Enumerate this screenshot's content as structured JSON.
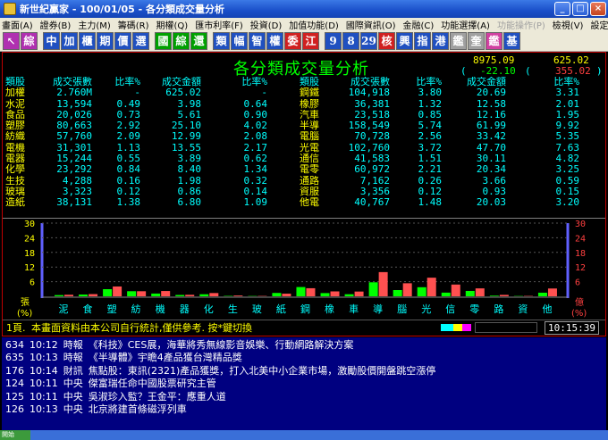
{
  "window": {
    "title": "新世紀贏家 - 100/01/05 - 各分類成交量分析",
    "min": "_",
    "max": "□",
    "close": "×"
  },
  "menu": [
    "畫面(A)",
    "證券(B)",
    "主力(M)",
    "籌碼(R)",
    "期權(Q)",
    "匯市利率(F)",
    "投資(D)",
    "加值功能(D)",
    "國際資訊(O)",
    "金融(C)",
    "功能選擇(A)",
    "功能操作(P)",
    "檢視(V)",
    "設定(S)",
    "工具(T)",
    "說明(H)"
  ],
  "menu_disabled": [
    11
  ],
  "toolbar": [
    {
      "t": "↖",
      "bg": "#b030b0"
    },
    {
      "t": "綜",
      "bg": "#b030b0"
    },
    {
      "t": "中",
      "bg": "#2050c0"
    },
    {
      "t": "加",
      "bg": "#2050c0"
    },
    {
      "t": "櫃",
      "bg": "#2050c0"
    },
    {
      "t": "期",
      "bg": "#2050c0"
    },
    {
      "t": "價",
      "bg": "#2050c0"
    },
    {
      "t": "選",
      "bg": "#2050c0"
    },
    {
      "t": "國",
      "bg": "#00a000"
    },
    {
      "t": "綜",
      "bg": "#00a000"
    },
    {
      "t": "還",
      "bg": "#00a000"
    },
    {
      "t": "類",
      "bg": "#2050c0"
    },
    {
      "t": "幅",
      "bg": "#2050c0"
    },
    {
      "t": "智",
      "bg": "#2050c0"
    },
    {
      "t": "權",
      "bg": "#2050c0"
    },
    {
      "t": "委",
      "bg": "#d02020"
    },
    {
      "t": "江",
      "bg": "#d02020"
    },
    {
      "t": "9",
      "bg": "#2050c0"
    },
    {
      "t": "8",
      "bg": "#2050c0"
    },
    {
      "t": "29",
      "bg": "#2050c0"
    },
    {
      "t": "核",
      "bg": "#d02020"
    },
    {
      "t": "興",
      "bg": "#2050c0"
    },
    {
      "t": "指",
      "bg": "#2050c0"
    },
    {
      "t": "港",
      "bg": "#2050c0"
    },
    {
      "t": "鑑",
      "bg": "#a0a0a0"
    },
    {
      "t": "奎",
      "bg": "#a0a0a0"
    },
    {
      "t": "鑑",
      "bg": "#d040a0"
    },
    {
      "t": "基",
      "bg": "#2050c0"
    }
  ],
  "header": {
    "title": "各分類成交量分析",
    "index_value": "8975.09",
    "index_change": "-22.10",
    "index2_value": "625.02",
    "index2_change": "355.02",
    "paren_open": "(",
    "paren_close": ")"
  },
  "columns": [
    "類股",
    "成交張數",
    "比率%",
    "成交金額",
    "比率%"
  ],
  "left_rows": [
    [
      "加權",
      "2.760M",
      "-",
      "625.02",
      "-"
    ],
    [
      "水泥",
      "13,594",
      "0.49",
      "3.98",
      "0.64"
    ],
    [
      "食品",
      "20,026",
      "0.73",
      "5.61",
      "0.90"
    ],
    [
      "塑膠",
      "80,663",
      "2.92",
      "25.10",
      "4.02"
    ],
    [
      "紡織",
      "57,760",
      "2.09",
      "12.99",
      "2.08"
    ],
    [
      "電機",
      "31,301",
      "1.13",
      "13.55",
      "2.17"
    ],
    [
      "電器",
      "15,244",
      "0.55",
      "3.89",
      "0.62"
    ],
    [
      "化學",
      "23,292",
      "0.84",
      "8.40",
      "1.34"
    ],
    [
      "生技",
      "4,288",
      "0.16",
      "1.98",
      "0.32"
    ],
    [
      "玻璃",
      "3,323",
      "0.12",
      "0.86",
      "0.14"
    ],
    [
      "造紙",
      "38,131",
      "1.38",
      "6.80",
      "1.09"
    ]
  ],
  "right_rows": [
    [
      "鋼鐵",
      "104,918",
      "3.80",
      "20.69",
      "3.31"
    ],
    [
      "橡膠",
      "36,381",
      "1.32",
      "12.58",
      "2.01"
    ],
    [
      "汽車",
      "23,518",
      "0.85",
      "12.16",
      "1.95"
    ],
    [
      "半導",
      "158,549",
      "5.74",
      "61.99",
      "9.92"
    ],
    [
      "電腦",
      "70,728",
      "2.56",
      "33.42",
      "5.35"
    ],
    [
      "光電",
      "102,760",
      "3.72",
      "47.70",
      "7.63"
    ],
    [
      "通信",
      "41,583",
      "1.51",
      "30.11",
      "4.82"
    ],
    [
      "電零",
      "60,972",
      "2.21",
      "20.34",
      "3.25"
    ],
    [
      "通路",
      "7,162",
      "0.26",
      "3.66",
      "0.59"
    ],
    [
      "資服",
      "3,356",
      "0.12",
      "0.93",
      "0.15"
    ],
    [
      "他電",
      "40,767",
      "1.48",
      "20.03",
      "3.20"
    ]
  ],
  "chart_data": {
    "type": "bar",
    "ylim": [
      0,
      30
    ],
    "yticks": [
      "30",
      "24",
      "18",
      "12",
      "6"
    ],
    "ylabel": "張 (%)",
    "ylabel_right": "億 (%)",
    "ylabel_left_top": "張",
    "ylabel_left_bottom": "(%)",
    "ylabel_right_top": "億",
    "ylabel_right_bottom": "(%)",
    "categories": [
      "泥",
      "食",
      "塑",
      "紡",
      "機",
      "器",
      "化",
      "生",
      "玻",
      "紙",
      "鋼",
      "橡",
      "車",
      "導",
      "腦",
      "光",
      "信",
      "零",
      "路",
      "資",
      "他"
    ],
    "series": [
      {
        "name": "成交張數比率",
        "color": "#00ff00",
        "values": [
          0.49,
          0.73,
          2.92,
          2.09,
          1.13,
          0.55,
          0.84,
          0.16,
          0.12,
          1.38,
          3.8,
          1.32,
          0.85,
          5.74,
          2.56,
          3.72,
          1.51,
          2.21,
          0.26,
          0.12,
          1.48
        ]
      },
      {
        "name": "成交金額比率",
        "color": "#ff5050",
        "values": [
          0.64,
          0.9,
          4.02,
          2.08,
          2.17,
          0.62,
          1.34,
          0.32,
          0.14,
          1.09,
          3.31,
          2.01,
          1.95,
          9.92,
          5.35,
          7.63,
          4.82,
          3.25,
          0.59,
          0.15,
          3.2
        ]
      }
    ]
  },
  "status": {
    "page": "1頁.",
    "message": "本畫面資料由本公司自行統計,僅供參考. 按*鍵切換",
    "time": "10:15:39"
  },
  "news": [
    [
      "634",
      "10:12",
      "時報",
      "《科技》CES展，海華將秀無線影音娛樂、行動網路解決方案"
    ],
    [
      "635",
      "10:13",
      "時報",
      "《半導體》宇瞻4產品獲台灣精品獎"
    ],
    [
      "176",
      "10:14",
      "財訊",
      "焦點股：東訊(2321)產品獲獎，打入北美中小企業市場，激勵股價開盤跳空漲停"
    ],
    [
      "124",
      "10:11",
      "中央",
      "傑富瑞任命中國股票研究主管"
    ],
    [
      "125",
      "10:11",
      "中央",
      "吳淑珍入監？王金平：應重人道"
    ],
    [
      "126",
      "10:13",
      "中央",
      "北京將建首條磁浮列車"
    ]
  ],
  "taskbar": {
    "start": "開始"
  }
}
